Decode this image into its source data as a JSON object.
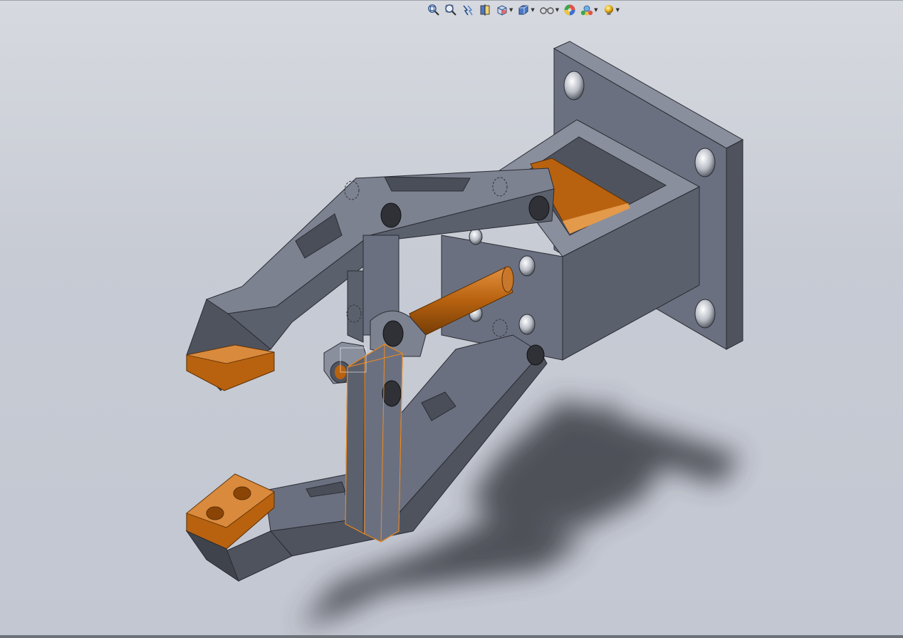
{
  "window": {
    "background_top": "#d6d9df",
    "background_bottom": "#c3c7d1"
  },
  "heads_up_toolbar": {
    "buttons": [
      {
        "icon": "zoom-to-fit-icon",
        "has_dropdown": false
      },
      {
        "icon": "zoom-to-area-icon",
        "has_dropdown": false
      },
      {
        "icon": "previous-view-icon",
        "has_dropdown": false
      },
      {
        "icon": "section-view-icon",
        "has_dropdown": false
      },
      {
        "icon": "view-orientation-icon",
        "has_dropdown": true
      },
      {
        "icon": "display-style-icon",
        "has_dropdown": true
      },
      {
        "icon": "hide-show-items-icon",
        "has_dropdown": true
      },
      {
        "icon": "edit-appearance-icon",
        "has_dropdown": false
      },
      {
        "icon": "apply-scene-icon",
        "has_dropdown": true
      },
      {
        "icon": "view-settings-icon",
        "has_dropdown": true
      }
    ]
  },
  "model": {
    "name": "gripper-assembly",
    "part_color": "#6b7080",
    "accent_color": "#b8620f",
    "selection_color": "#f08a1c",
    "shadow_color": "#3a3d44"
  }
}
